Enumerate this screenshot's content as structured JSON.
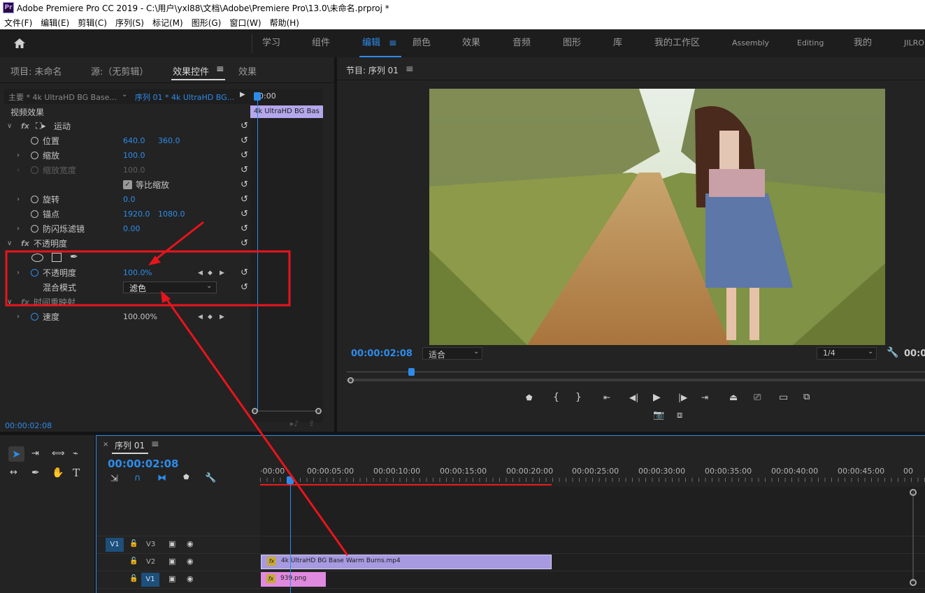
{
  "title_bar": {
    "logo": "Pr",
    "text": "Adobe Premiere Pro CC 2019 - C:\\用户\\yxl88\\文档\\Adobe\\Premiere Pro\\13.0\\未命名.prproj *"
  },
  "menu": [
    "文件(F)",
    "编辑(E)",
    "剪辑(C)",
    "序列(S)",
    "标记(M)",
    "图形(G)",
    "窗口(W)",
    "帮助(H)"
  ],
  "workspaces": {
    "items": [
      "学习",
      "组件",
      "编辑",
      "颜色",
      "效果",
      "音频",
      "图形",
      "库",
      "我的工作区",
      "Assembly",
      "Editing",
      "我的",
      "JILRO"
    ],
    "active": "编辑",
    "menu_icon": "hamburger-icon"
  },
  "left_panel": {
    "tabs": [
      "项目: 未命名",
      "源:（无剪辑）",
      "效果控件",
      "效果"
    ],
    "active_tab": "效果控件",
    "master_clip": "主要 * 4k UltraHD BG Base...",
    "sequence_clip": "序列 01 * 4k UltraHD BG...",
    "mini_timecode": "00:00",
    "mini_clip": "4k UltraHD BG Bas",
    "section_video": "视频效果",
    "motion": {
      "name": "运动",
      "position": {
        "label": "位置",
        "x": "640.0",
        "y": "360.0"
      },
      "scale": {
        "label": "缩放",
        "value": "100.0"
      },
      "scale_width": {
        "label": "缩放宽度",
        "value": "100.0"
      },
      "uniform_scale": "等比缩放",
      "rotation": {
        "label": "旋转",
        "value": "0.0"
      },
      "anchor": {
        "label": "锚点",
        "x": "1920.0",
        "y": "1080.0"
      },
      "anti_flicker": {
        "label": "防闪烁滤镜",
        "value": "0.00"
      }
    },
    "opacity": {
      "name": "不透明度",
      "opacity": {
        "label": "不透明度",
        "value": "100.0",
        "unit": "%"
      },
      "blend": {
        "label": "混合模式",
        "value": "滤色"
      }
    },
    "time_remap": {
      "name": "时间重映射",
      "speed": {
        "label": "速度",
        "value": "100.00%"
      }
    },
    "timecode": "00:00:02:08"
  },
  "program_monitor": {
    "title": "节目: 序列 01",
    "timecode": "00:00:02:08",
    "fit": "适合",
    "resolution": "1/4",
    "right_timecode": "00:0"
  },
  "tools": [
    "selection-tool",
    "track-select-tool",
    "ripple-edit-tool",
    "razor-tool",
    "slip-tool",
    "pen-tool",
    "hand-tool",
    "type-tool"
  ],
  "timeline": {
    "title": "序列 01",
    "timecode": "00:00:02:08",
    "ruler": [
      "·00:00",
      "00:00:05:00",
      "00:00:10:00",
      "00:00:15:00",
      "00:00:20:00",
      "00:00:25:00",
      "00:00:30:00",
      "00:00:35:00",
      "00:00:40:00",
      "00:00:45:00",
      "00"
    ],
    "tracks": [
      {
        "source": "V1",
        "name": "V3"
      },
      {
        "source": "",
        "name": "V2"
      },
      {
        "source": "",
        "name": "V1"
      }
    ],
    "clips": [
      {
        "name": "4k UltraHD BG Base Warm Burns.mp4",
        "track": "V2",
        "badge": "fx"
      },
      {
        "name": "939.png",
        "track": "V1",
        "badge": "fx"
      }
    ]
  },
  "colors": {
    "accent": "#2d8ceb",
    "clip_purple": "#a79ae0",
    "clip_pink": "#e08adf",
    "annotation_red": "#e8141c"
  }
}
